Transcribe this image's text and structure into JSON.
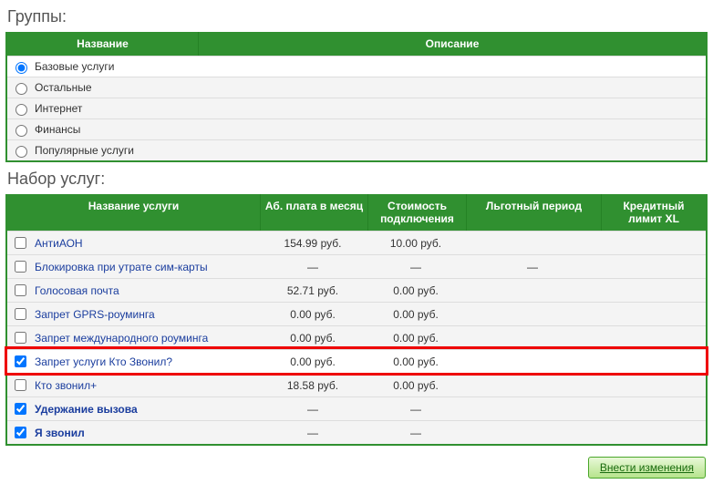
{
  "groups": {
    "title": "Группы:",
    "columns": {
      "name": "Название",
      "desc": "Описание"
    },
    "items": [
      {
        "label": "Базовые услуги",
        "selected": true
      },
      {
        "label": "Остальные",
        "selected": false
      },
      {
        "label": "Интернет",
        "selected": false
      },
      {
        "label": "Финансы",
        "selected": false
      },
      {
        "label": "Популярные услуги",
        "selected": false
      }
    ]
  },
  "services": {
    "title": "Набор услуг:",
    "columns": {
      "name": "Название услуги",
      "fee": "Аб. плата в месяц",
      "conn": "Стоимость подключения",
      "grace": "Льготный период",
      "credit": "Кредитный лимит XL"
    },
    "items": [
      {
        "checked": false,
        "name": "АнтиАОН",
        "fee": "154.99 руб.",
        "conn": "10.00 руб.",
        "grace": "",
        "credit": "",
        "bold": false,
        "highlight": false
      },
      {
        "checked": false,
        "name": "Блокировка при утрате сим-карты",
        "fee": "—",
        "conn": "—",
        "grace": "—",
        "credit": "",
        "bold": false,
        "highlight": false
      },
      {
        "checked": false,
        "name": "Голосовая почта",
        "fee": "52.71 руб.",
        "conn": "0.00 руб.",
        "grace": "",
        "credit": "",
        "bold": false,
        "highlight": false
      },
      {
        "checked": false,
        "name": "Запрет GPRS-роуминга",
        "fee": "0.00 руб.",
        "conn": "0.00 руб.",
        "grace": "",
        "credit": "",
        "bold": false,
        "highlight": false
      },
      {
        "checked": false,
        "name": "Запрет международного роуминга",
        "fee": "0.00 руб.",
        "conn": "0.00 руб.",
        "grace": "",
        "credit": "",
        "bold": false,
        "highlight": false
      },
      {
        "checked": true,
        "name": "Запрет услуги Кто Звонил?",
        "fee": "0.00 руб.",
        "conn": "0.00 руб.",
        "grace": "",
        "credit": "",
        "bold": false,
        "highlight": true
      },
      {
        "checked": false,
        "name": "Кто звонил+",
        "fee": "18.58 руб.",
        "conn": "0.00 руб.",
        "grace": "",
        "credit": "",
        "bold": false,
        "highlight": false
      },
      {
        "checked": true,
        "name": "Удержание вызова",
        "fee": "—",
        "conn": "—",
        "grace": "",
        "credit": "",
        "bold": true,
        "highlight": false
      },
      {
        "checked": true,
        "name": "Я звонил",
        "fee": "—",
        "conn": "—",
        "grace": "",
        "credit": "",
        "bold": true,
        "highlight": false
      }
    ]
  },
  "actions": {
    "submit": "Внести изменения"
  }
}
